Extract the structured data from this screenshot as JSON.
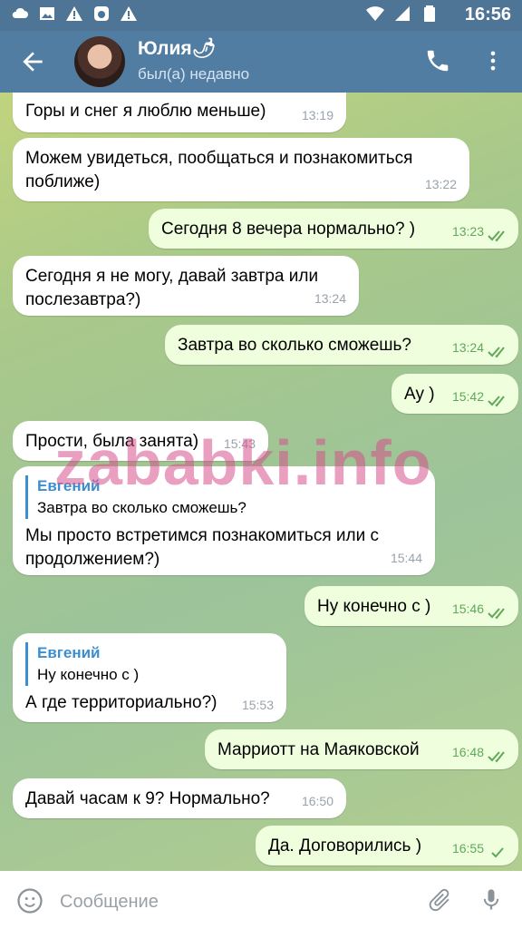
{
  "statusbar": {
    "time": "16:56"
  },
  "header": {
    "name": "Юлия",
    "name_emoji": "🌶",
    "status": "был(а) недавно"
  },
  "messages": [
    {
      "dir": "in",
      "text": "Горы и снег я люблю меньше)",
      "time": "13:19"
    },
    {
      "dir": "in",
      "text": "Можем увидеться, пообщаться и познакомиться поближе)",
      "time": "13:22"
    },
    {
      "dir": "out",
      "text": "Сегодня 8 вечера нормально? )",
      "time": "13:23"
    },
    {
      "dir": "in",
      "text": "Сегодня я не могу, давай завтра или послезавтра?)",
      "time": "13:24"
    },
    {
      "dir": "out",
      "text": "Завтра во сколько сможешь?",
      "time": "13:24"
    },
    {
      "dir": "out",
      "text": "Ау )",
      "time": "15:42"
    },
    {
      "dir": "in",
      "text": "Прости, была занята)",
      "time": "15:43"
    },
    {
      "dir": "in",
      "reply_name": "Евгений",
      "reply_text": "Завтра во сколько сможешь?",
      "text": "Мы просто встретимся познакомиться или с продолжением?)",
      "time": "15:44"
    },
    {
      "dir": "out",
      "text": "Ну конечно с )",
      "time": "15:46"
    },
    {
      "dir": "in",
      "reply_name": "Евгений",
      "reply_text": "Ну конечно с )",
      "text": "А где территориально?)",
      "time": "15:53"
    },
    {
      "dir": "out",
      "text": "Марриотт на Маяковской",
      "time": "16:48"
    },
    {
      "dir": "in",
      "text": "Давай часам к 9? Нормально?",
      "time": "16:50"
    },
    {
      "dir": "out",
      "text": "Да. Договорились )",
      "time": "16:55"
    }
  ],
  "watermark": "zababki.info",
  "composer": {
    "placeholder": "Сообщение"
  },
  "colors": {
    "header": "#527da3",
    "incoming_bubble": "#ffffff",
    "outgoing_bubble": "#effedd",
    "read_ticks": "#5fa859",
    "reply_accent": "#3b8ed0"
  },
  "icons": {
    "back": "arrow-left-icon",
    "call": "phone-icon",
    "more": "more-vertical-icon",
    "emoji": "smile-icon",
    "attach": "paperclip-icon",
    "mic": "microphone-icon",
    "read": "double-check-icon"
  }
}
